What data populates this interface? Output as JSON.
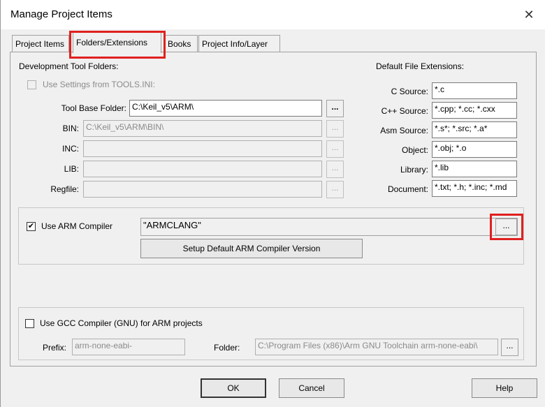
{
  "window": {
    "title": "Manage Project Items",
    "close_glyph": "✕"
  },
  "tabs": [
    {
      "label": "Project Items"
    },
    {
      "label": "Folders/Extensions"
    },
    {
      "label": "Books"
    },
    {
      "label": "Project Info/Layer"
    }
  ],
  "dev_tool_folders": {
    "heading": "Development Tool Folders:",
    "use_tools_ini_label": "Use Settings from TOOLS.INI:",
    "tool_base_label": "Tool Base Folder:",
    "tool_base_value": "C:\\Keil_v5\\ARM\\",
    "bin_label": "BIN:",
    "bin_value": "C:\\Keil_v5\\ARM\\BIN\\",
    "inc_label": "INC:",
    "inc_value": "",
    "lib_label": "LIB:",
    "lib_value": "",
    "regfile_label": "Regfile:",
    "regfile_value": "",
    "browse_label": "..."
  },
  "extensions": {
    "heading": "Default File Extensions:",
    "c_label": "C Source:",
    "c_value": "*.c",
    "cpp_label": "C++ Source:",
    "cpp_value": "*.cpp; *.cc; *.cxx",
    "asm_label": "Asm Source:",
    "asm_value": "*.s*; *.src; *.a*",
    "obj_label": "Object:",
    "obj_value": "*.obj; *.o",
    "lib_label": "Library:",
    "lib_value": "*.lib",
    "doc_label": "Document:",
    "doc_value": "*.txt; *.h; *.inc; *.md"
  },
  "arm_compiler": {
    "checked": true,
    "label": "Use ARM Compiler",
    "value": "\"ARMCLANG\"",
    "browse_label": "...",
    "setup_button": "Setup Default ARM Compiler Version"
  },
  "gcc": {
    "checked": false,
    "label": "Use GCC Compiler (GNU) for ARM projects",
    "prefix_label": "Prefix:",
    "prefix_value": "arm-none-eabi-",
    "folder_label": "Folder:",
    "folder_value": "C:\\Program Files (x86)\\Arm GNU Toolchain arm-none-eabi\\",
    "browse_label": "..."
  },
  "footer": {
    "ok": "OK",
    "cancel": "Cancel",
    "help": "Help"
  },
  "check_glyph": "✔",
  "colors": {
    "highlight": "#e0201e",
    "dialog_bg": "#f0f0f0"
  }
}
